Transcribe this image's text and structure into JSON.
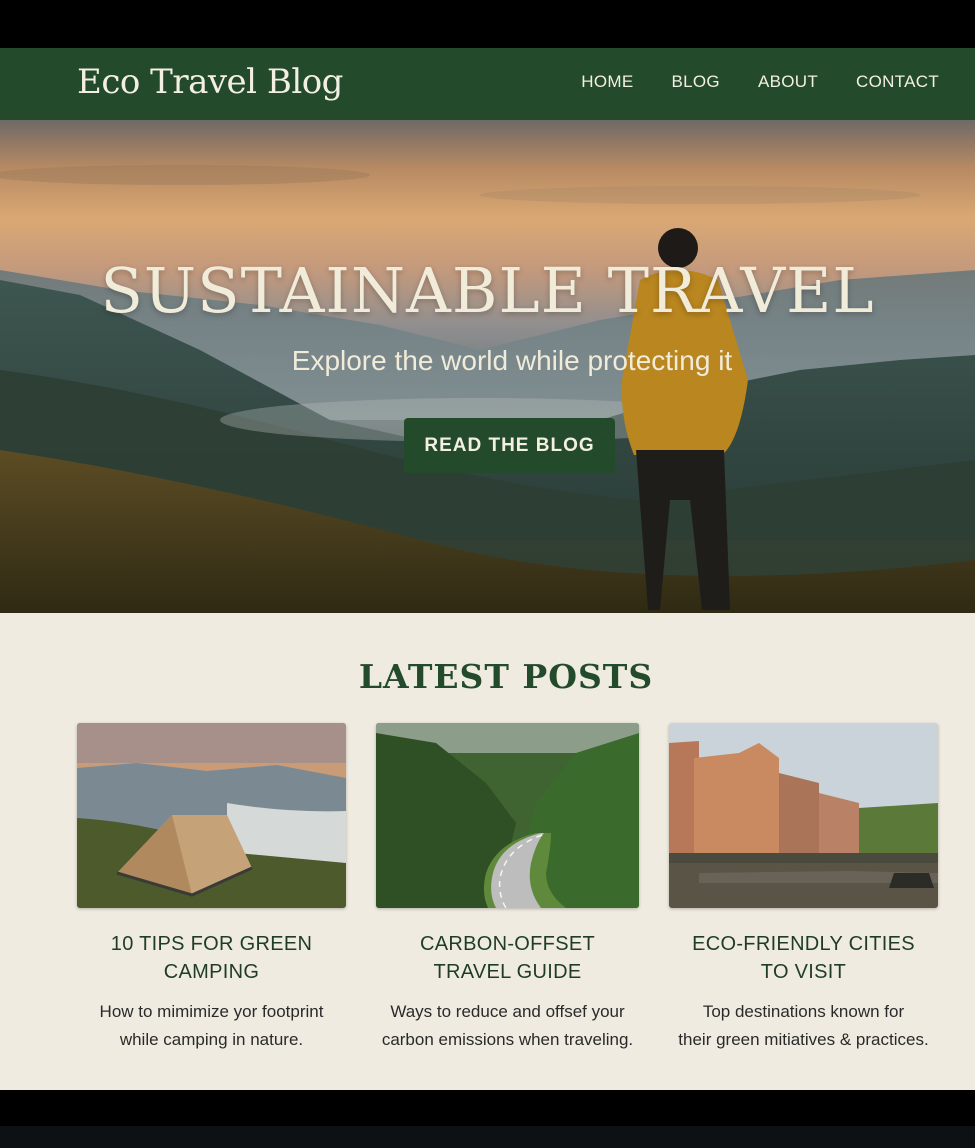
{
  "header": {
    "brand": "Eco Travel Blog",
    "nav": [
      "HOME",
      "BLOG",
      "ABOUT",
      "CONTACT"
    ]
  },
  "hero": {
    "title": "SUSTAINABLE TRAVEL",
    "subtitle": "Explore the world while protecting it",
    "cta": "READ THE BLOG"
  },
  "posts": {
    "heading": "LATEST POSTS",
    "items": [
      {
        "title_line1": "10 TIPS FOR GREEN",
        "title_line2": "CAMPING",
        "desc_line1": "How to mimimize yor footprint",
        "desc_line2": "while camping in nature."
      },
      {
        "title_line1": "CARBON-OFFSET",
        "title_line2": "TRAVEL GUIDE",
        "desc_line1": "Ways to reduce and offsef your",
        "desc_line2": "carbon emissions when traveling."
      },
      {
        "title_line1": "ECO-FRIENDLY CITIES",
        "title_line2": "TO VISIT",
        "desc_line1": "Top destinations known for",
        "desc_line2": "their green mitiatives & practices."
      }
    ]
  },
  "colors": {
    "brand_green": "#244a2c",
    "cream": "#efebe0",
    "text_light": "#f3efe2"
  }
}
